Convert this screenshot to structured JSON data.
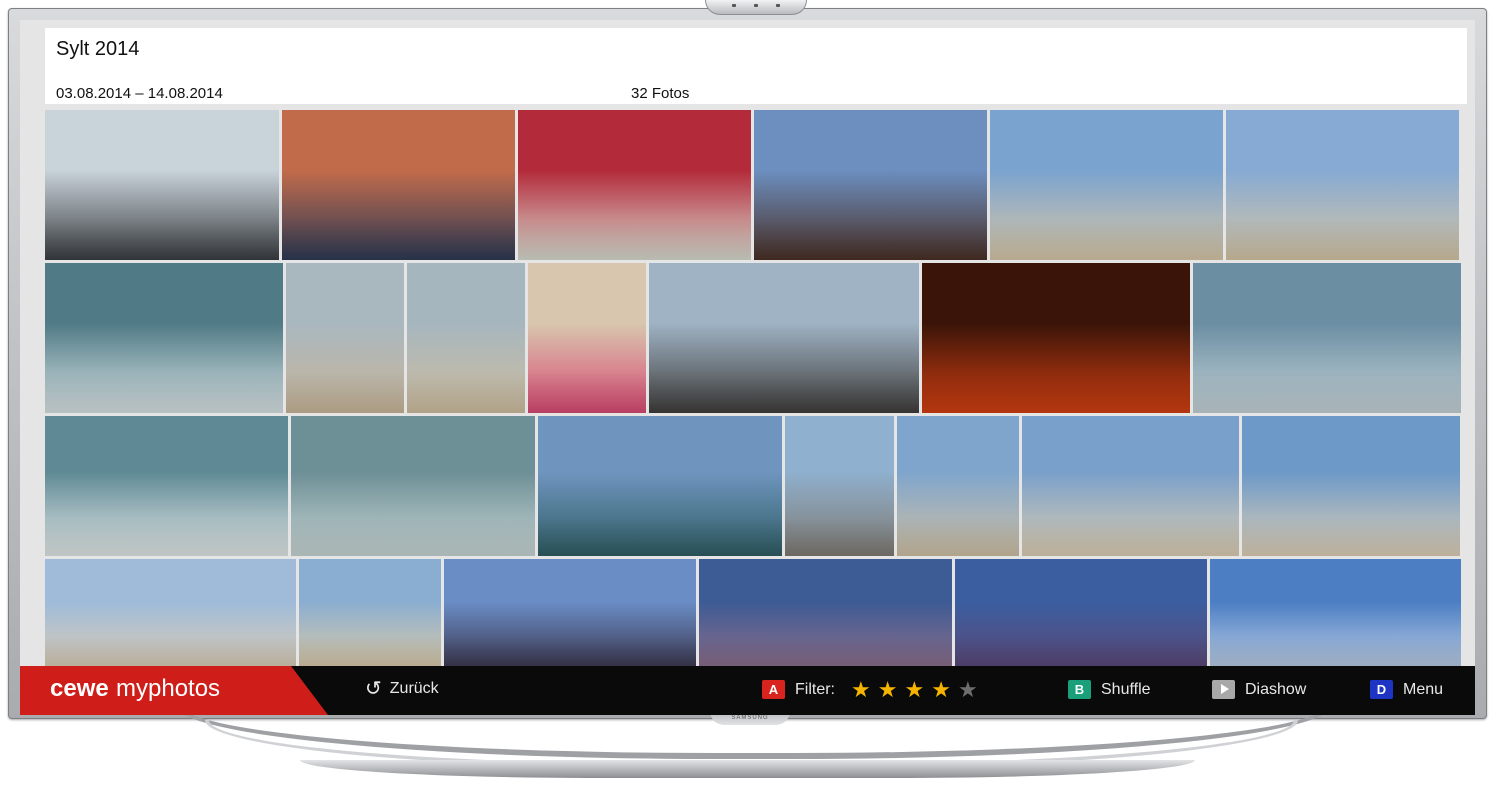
{
  "album": {
    "title": "Sylt 2014",
    "dates": "03.08.2014 – 14.08.2014",
    "count": "32 Fotos"
  },
  "rows": [
    [
      {
        "name": "car-mirror-sea",
        "c1": "#c9d3da",
        "c2": "#3a3d41"
      },
      {
        "name": "two-men-at-table",
        "c1": "#c26b4b",
        "c2": "#2d3a55"
      },
      {
        "name": "couple-on-red-sofa",
        "c1": "#b32a3a",
        "c2": "#d8dcd0"
      },
      {
        "name": "beach-restaurant-dusk",
        "c1": "#6c8fc0",
        "c2": "#4a3026"
      },
      {
        "name": "beach-volleyball-players",
        "c1": "#7aa3cf",
        "c2": "#d8c7a7"
      },
      {
        "name": "beach-volleyball-serve",
        "c1": "#86aad3",
        "c2": "#d5c5a5"
      }
    ],
    [
      {
        "name": "surfer-in-waves",
        "c1": "#4f7a86",
        "c2": "#d8e2e4"
      },
      {
        "name": "surfer-with-board-1",
        "c1": "#a9b7bf",
        "c2": "#c9b69a"
      },
      {
        "name": "surfer-with-board-2",
        "c1": "#a6b6bf",
        "c2": "#cfbe9f"
      },
      {
        "name": "woman-sitting-sunglasses",
        "c1": "#d8c7ae",
        "c2": "#d84a74"
      },
      {
        "name": "group-of-surfers",
        "c1": "#9fb3c4",
        "c2": "#3f3d3b"
      },
      {
        "name": "sunset-red-clouds",
        "c1": "#3a1408",
        "c2": "#d23f12"
      },
      {
        "name": "surfer-on-board",
        "c1": "#6b8ea3",
        "c2": "#c4d2d6"
      }
    ],
    [
      {
        "name": "surfer-riding-wave",
        "c1": "#5f8a95",
        "c2": "#e1e7e6"
      },
      {
        "name": "surfer-paddling",
        "c1": "#6d8f96",
        "c2": "#c8d5d4"
      },
      {
        "name": "surfers-in-sea",
        "c1": "#6f95bf",
        "c2": "#2f5d63"
      },
      {
        "name": "surfer-carrying-board",
        "c1": "#8fb0ce",
        "c2": "#7f7a72"
      },
      {
        "name": "volleyball-player-net",
        "c1": "#7fa5cd",
        "c2": "#cfc0a3"
      },
      {
        "name": "beach-volleyball-game",
        "c1": "#79a0ca",
        "c2": "#dccdb2"
      },
      {
        "name": "beach-volleyball-court",
        "c1": "#6d99c8",
        "c2": "#ddcfb6"
      }
    ],
    [
      {
        "name": "beach-camp",
        "c1": "#9fbbd9",
        "c2": "#d9ccb6"
      },
      {
        "name": "volleyball-net-players",
        "c1": "#8aaed1",
        "c2": "#d9c9a9"
      },
      {
        "name": "selfie-at-sunset",
        "c1": "#6a8dc6",
        "c2": "#3d3a52"
      },
      {
        "name": "windsurf-boards-dusk",
        "c1": "#3d5b95",
        "c2": "#8a6d8a"
      },
      {
        "name": "windsurf-boards-evening",
        "c1": "#3b5ea0",
        "c2": "#5a4878"
      },
      {
        "name": "seagull-in-sky",
        "c1": "#4c7ec4",
        "c2": "#b8cbe3"
      }
    ]
  ],
  "footer": {
    "logo_a": "cewe",
    "logo_b": "myphotos",
    "back": "Zurück",
    "filter_key": "A",
    "filter_label": "Filter:",
    "rating": 4,
    "rating_max": 5,
    "shuffle_key": "B",
    "shuffle_label": "Shuffle",
    "slideshow_label": "Diashow",
    "menu_key": "D",
    "menu_label": "Menu"
  },
  "tv_brand": "SAMSUNG"
}
